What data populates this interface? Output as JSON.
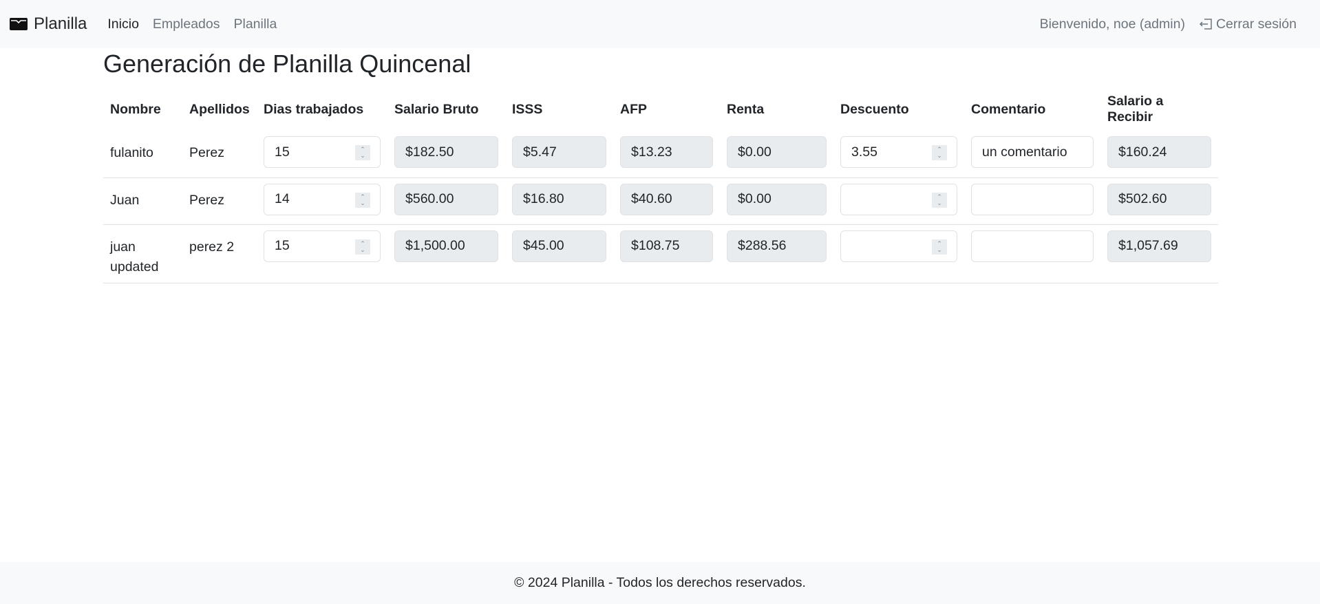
{
  "navbar": {
    "brand": "Planilla",
    "links": [
      "Inicio",
      "Empleados",
      "Planilla"
    ],
    "welcome": "Bienvenido, noe (admin)",
    "logout": "Cerrar sesión"
  },
  "page_title": "Generación de Planilla Quincenal",
  "table": {
    "headers": [
      "Nombre",
      "Apellidos",
      "Dias trabajados",
      "Salario Bruto",
      "ISSS",
      "AFP",
      "Renta",
      "Descuento",
      "Comentario",
      "Salario a Recibir"
    ],
    "rows": [
      {
        "nombre": "fulanito",
        "apellidos": "Perez",
        "dias": "15",
        "bruto": "$182.50",
        "isss": "$5.47",
        "afp": "$13.23",
        "renta": "$0.00",
        "descuento": "3.55",
        "comentario": "un comentario",
        "neto": "$160.24"
      },
      {
        "nombre": "Juan",
        "apellidos": "Perez",
        "dias": "14",
        "bruto": "$560.00",
        "isss": "$16.80",
        "afp": "$40.60",
        "renta": "$0.00",
        "descuento": "",
        "comentario": "",
        "neto": "$502.60"
      },
      {
        "nombre": "juan updated",
        "apellidos": "perez 2",
        "dias": "15",
        "bruto": "$1,500.00",
        "isss": "$45.00",
        "afp": "$108.75",
        "renta": "$288.56",
        "descuento": "",
        "comentario": "",
        "neto": "$1,057.69"
      }
    ]
  },
  "footer": "© 2024 Planilla - Todos los derechos reservados."
}
